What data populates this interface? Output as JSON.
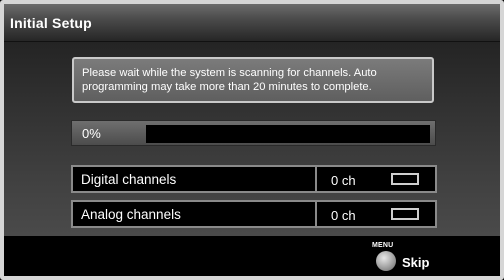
{
  "title": "Initial Setup",
  "message": "Please wait while the system is scanning for channels. Auto programming may take more than 20 minutes to complete.",
  "progress": {
    "label": "0%",
    "value_percent": 0
  },
  "channels": [
    {
      "label": "Digital channels",
      "value": "0 ch"
    },
    {
      "label": "Analog channels",
      "value": "0 ch"
    }
  ],
  "footer": {
    "menu_key_label": "MENU",
    "menu_key_icon": "round-button-icon",
    "skip_label": "Skip"
  },
  "colors": {
    "frame_border": "#d6d6d6",
    "title_text": "#ffffff",
    "progress_track": "#000000",
    "row_border": "#8a8a8a"
  }
}
